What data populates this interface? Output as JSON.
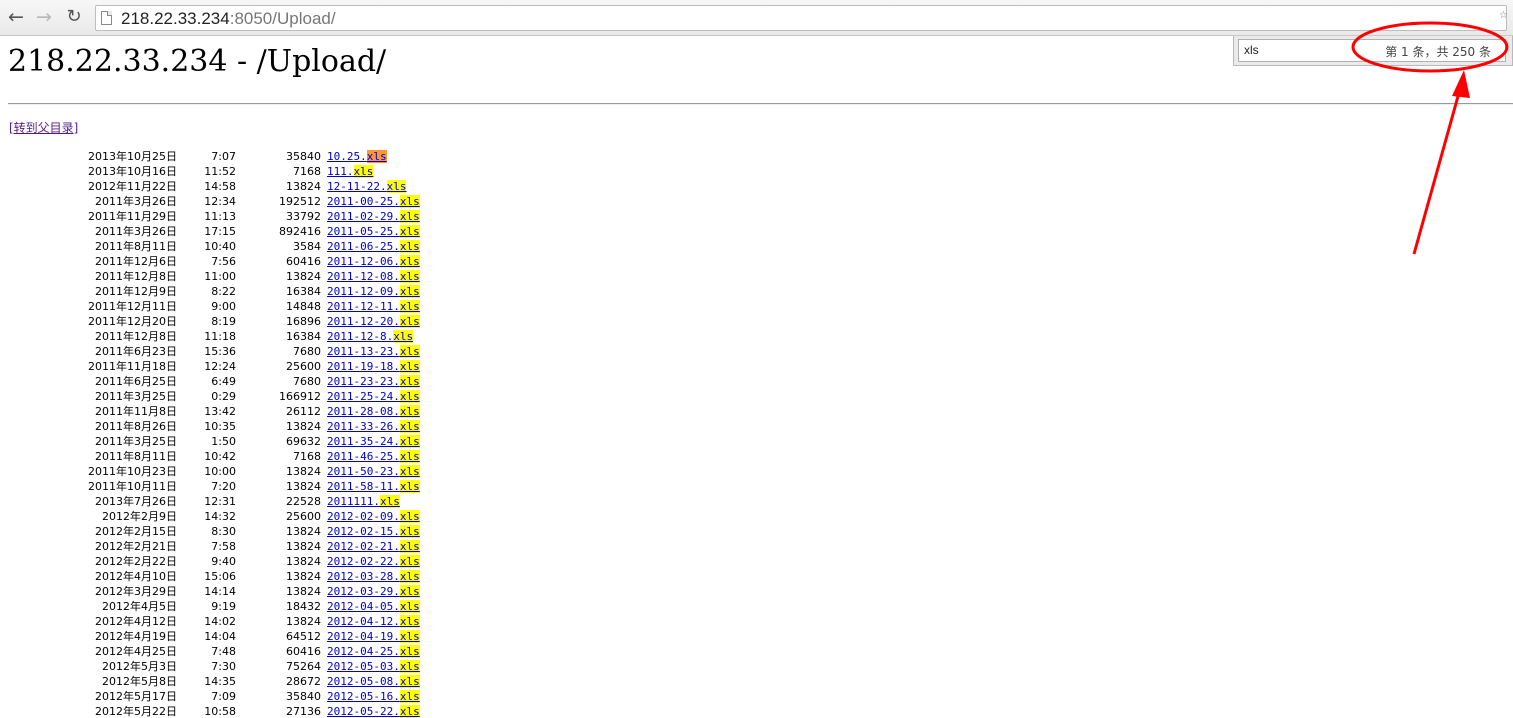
{
  "browser": {
    "url_host": "218.22.33.234",
    "url_rest": ":8050/Upload/",
    "back_icon": "arrow-left",
    "forward_icon": "arrow-right",
    "reload_icon": "reload",
    "find": {
      "query": "xls",
      "count_text": "第 1 条，共 250 条"
    }
  },
  "page": {
    "title": "218.22.33.234 - /Upload/",
    "parent_link": "[转到父目录]"
  },
  "files": [
    {
      "date": "2013年10月25日",
      "time": "7:07",
      "size": "35840",
      "base": "10.25.",
      "ext": "xls",
      "current": true
    },
    {
      "date": "2013年10月16日",
      "time": "11:52",
      "size": "7168",
      "base": "111.",
      "ext": "xls"
    },
    {
      "date": "2012年11月22日",
      "time": "14:58",
      "size": "13824",
      "base": "12-11-22.",
      "ext": "xls"
    },
    {
      "date": "2011年3月26日",
      "time": "12:34",
      "size": "192512",
      "base": "2011-00-25.",
      "ext": "xls"
    },
    {
      "date": "2011年11月29日",
      "time": "11:13",
      "size": "33792",
      "base": "2011-02-29.",
      "ext": "xls"
    },
    {
      "date": "2011年3月26日",
      "time": "17:15",
      "size": "892416",
      "base": "2011-05-25.",
      "ext": "xls"
    },
    {
      "date": "2011年8月11日",
      "time": "10:40",
      "size": "3584",
      "base": "2011-06-25.",
      "ext": "xls"
    },
    {
      "date": "2011年12月6日",
      "time": "7:56",
      "size": "60416",
      "base": "2011-12-06.",
      "ext": "xls"
    },
    {
      "date": "2011年12月8日",
      "time": "11:00",
      "size": "13824",
      "base": "2011-12-08.",
      "ext": "xls"
    },
    {
      "date": "2011年12月9日",
      "time": "8:22",
      "size": "16384",
      "base": "2011-12-09.",
      "ext": "xls"
    },
    {
      "date": "2011年12月11日",
      "time": "9:00",
      "size": "14848",
      "base": "2011-12-11.",
      "ext": "xls"
    },
    {
      "date": "2011年12月20日",
      "time": "8:19",
      "size": "16896",
      "base": "2011-12-20.",
      "ext": "xls"
    },
    {
      "date": "2011年12月8日",
      "time": "11:18",
      "size": "16384",
      "base": "2011-12-8.",
      "ext": "xls"
    },
    {
      "date": "2011年6月23日",
      "time": "15:36",
      "size": "7680",
      "base": "2011-13-23.",
      "ext": "xls"
    },
    {
      "date": "2011年11月18日",
      "time": "12:24",
      "size": "25600",
      "base": "2011-19-18.",
      "ext": "xls"
    },
    {
      "date": "2011年6月25日",
      "time": "6:49",
      "size": "7680",
      "base": "2011-23-23.",
      "ext": "xls"
    },
    {
      "date": "2011年3月25日",
      "time": "0:29",
      "size": "166912",
      "base": "2011-25-24.",
      "ext": "xls"
    },
    {
      "date": "2011年11月8日",
      "time": "13:42",
      "size": "26112",
      "base": "2011-28-08.",
      "ext": "xls"
    },
    {
      "date": "2011年8月26日",
      "time": "10:35",
      "size": "13824",
      "base": "2011-33-26.",
      "ext": "xls"
    },
    {
      "date": "2011年3月25日",
      "time": "1:50",
      "size": "69632",
      "base": "2011-35-24.",
      "ext": "xls"
    },
    {
      "date": "2011年8月11日",
      "time": "10:42",
      "size": "7168",
      "base": "2011-46-25.",
      "ext": "xls"
    },
    {
      "date": "2011年10月23日",
      "time": "10:00",
      "size": "13824",
      "base": "2011-50-23.",
      "ext": "xls"
    },
    {
      "date": "2011年10月11日",
      "time": "7:20",
      "size": "13824",
      "base": "2011-58-11.",
      "ext": "xls"
    },
    {
      "date": "2013年7月26日",
      "time": "12:31",
      "size": "22528",
      "base": "2011111.",
      "ext": "xls"
    },
    {
      "date": "2012年2月9日",
      "time": "14:32",
      "size": "25600",
      "base": "2012-02-09.",
      "ext": "xls"
    },
    {
      "date": "2012年2月15日",
      "time": "8:30",
      "size": "13824",
      "base": "2012-02-15.",
      "ext": "xls"
    },
    {
      "date": "2012年2月21日",
      "time": "7:58",
      "size": "13824",
      "base": "2012-02-21.",
      "ext": "xls"
    },
    {
      "date": "2012年2月22日",
      "time": "9:40",
      "size": "13824",
      "base": "2012-02-22.",
      "ext": "xls"
    },
    {
      "date": "2012年4月10日",
      "time": "15:06",
      "size": "13824",
      "base": "2012-03-28.",
      "ext": "xls"
    },
    {
      "date": "2012年3月29日",
      "time": "14:14",
      "size": "13824",
      "base": "2012-03-29.",
      "ext": "xls"
    },
    {
      "date": "2012年4月5日",
      "time": "9:19",
      "size": "18432",
      "base": "2012-04-05.",
      "ext": "xls"
    },
    {
      "date": "2012年4月12日",
      "time": "14:02",
      "size": "13824",
      "base": "2012-04-12.",
      "ext": "xls"
    },
    {
      "date": "2012年4月19日",
      "time": "14:04",
      "size": "64512",
      "base": "2012-04-19.",
      "ext": "xls"
    },
    {
      "date": "2012年4月25日",
      "time": "7:48",
      "size": "60416",
      "base": "2012-04-25.",
      "ext": "xls"
    },
    {
      "date": "2012年5月3日",
      "time": "7:30",
      "size": "75264",
      "base": "2012-05-03.",
      "ext": "xls"
    },
    {
      "date": "2012年5月8日",
      "time": "14:35",
      "size": "28672",
      "base": "2012-05-08.",
      "ext": "xls"
    },
    {
      "date": "2012年5月17日",
      "time": "7:09",
      "size": "35840",
      "base": "2012-05-16.",
      "ext": "xls"
    },
    {
      "date": "2012年5月22日",
      "time": "10:58",
      "size": "27136",
      "base": "2012-05-22.",
      "ext": "xls"
    }
  ],
  "colors": {
    "link": "#0000cc",
    "visited_link": "#551a8b",
    "match_highlight": "#ffff00",
    "current_match_highlight": "#ff9632",
    "annotation": "#ff0000"
  }
}
